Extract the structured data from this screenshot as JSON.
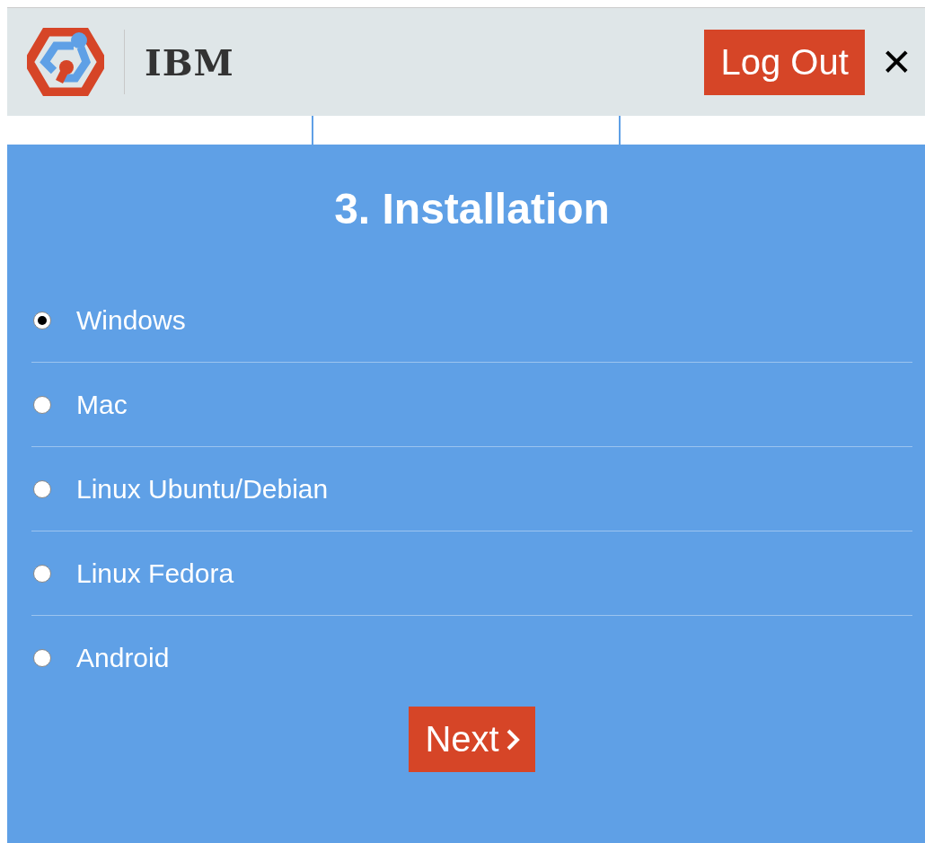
{
  "header": {
    "brand": "IBM",
    "logout": "Log Out",
    "close": "✕"
  },
  "title": "3. Installation",
  "options": [
    {
      "label": "Windows",
      "selected": true
    },
    {
      "label": "Mac",
      "selected": false
    },
    {
      "label": "Linux Ubuntu/Debian",
      "selected": false
    },
    {
      "label": "Linux Fedora",
      "selected": false
    },
    {
      "label": "Android",
      "selected": false
    }
  ],
  "next": "Next"
}
